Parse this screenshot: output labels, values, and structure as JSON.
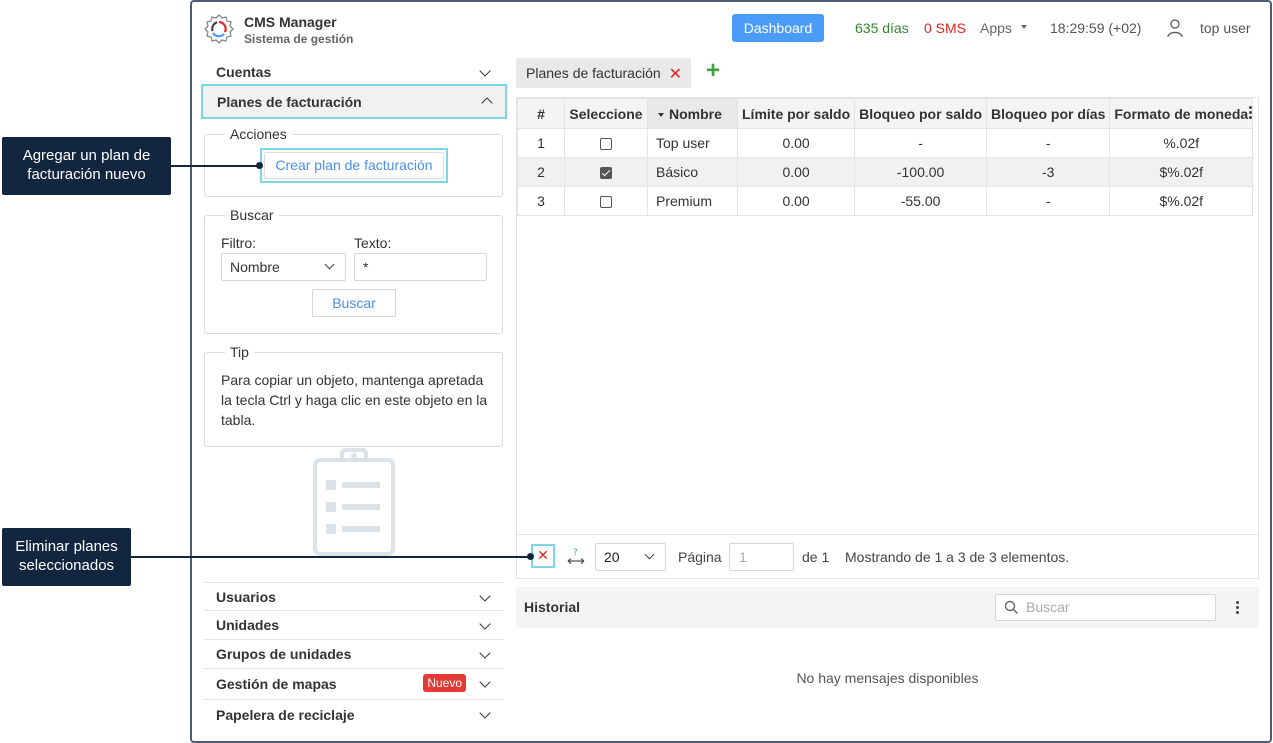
{
  "header": {
    "title": "CMS Manager",
    "subtitle": "Sistema de gestión",
    "dashboard_label": "Dashboard",
    "days": "635 días",
    "sms": "0 SMS",
    "apps_label": "Apps",
    "clock": "18:29:59 (+02)",
    "user_name": "top user"
  },
  "sidebar": {
    "top_items": [
      {
        "label": "Cuentas",
        "expanded": false
      },
      {
        "label": "Planes de facturación",
        "expanded": true
      }
    ],
    "acciones": {
      "legend": "Acciones",
      "create_label": "Crear plan de facturación"
    },
    "buscar": {
      "legend": "Buscar",
      "filter_label": "Filtro:",
      "filter_value": "Nombre",
      "text_label": "Texto:",
      "text_value": "*",
      "search_button": "Buscar"
    },
    "tip": {
      "legend": "Tip",
      "text": "Para copiar un objeto, mantenga apretada la tecla Ctrl y haga clic en este objeto en la tabla."
    },
    "bottom_items": [
      {
        "label": "Usuarios"
      },
      {
        "label": "Unidades"
      },
      {
        "label": "Grupos de unidades"
      },
      {
        "label": "Gestión de mapas",
        "badge": "Nuevo"
      },
      {
        "label": "Papelera de reciclaje"
      }
    ]
  },
  "tabs": [
    {
      "label": "Planes de facturación"
    }
  ],
  "table": {
    "columns": [
      "#",
      "Seleccione",
      "Nombre",
      "Límite por saldo",
      "Bloqueo por saldo",
      "Bloqueo por días",
      "Formato de moneda"
    ],
    "rows": [
      {
        "num": "1",
        "checked": false,
        "nombre": "Top user",
        "limite": "0.00",
        "bloqueo_saldo": "-",
        "bloqueo_dias": "-",
        "formato": "%.02f"
      },
      {
        "num": "2",
        "checked": true,
        "nombre": "Básico",
        "limite": "0.00",
        "bloqueo_saldo": "-100.00",
        "bloqueo_dias": "-3",
        "formato": "$%.02f"
      },
      {
        "num": "3",
        "checked": false,
        "nombre": "Premium",
        "limite": "0.00",
        "bloqueo_saldo": "-55.00",
        "bloqueo_dias": "-",
        "formato": "$%.02f"
      }
    ]
  },
  "pager": {
    "per_page": "20",
    "page_label": "Página",
    "page_value": "1",
    "of_label": "de 1",
    "showing": "Mostrando de 1 a 3 de 3 elementos."
  },
  "historial": {
    "title": "Historial",
    "search_placeholder": "Buscar",
    "empty": "No hay mensajes disponibles"
  },
  "callouts": {
    "create": "Agregar un plan de facturación nuevo",
    "delete": "Eliminar planes seleccionados"
  },
  "colors": {
    "accent": "#4b9bf8",
    "days": "#2e8b2e",
    "sms": "#e0241f",
    "highlight": "#7dd6e6",
    "callout": "#12263f",
    "badge": "#e53935"
  }
}
